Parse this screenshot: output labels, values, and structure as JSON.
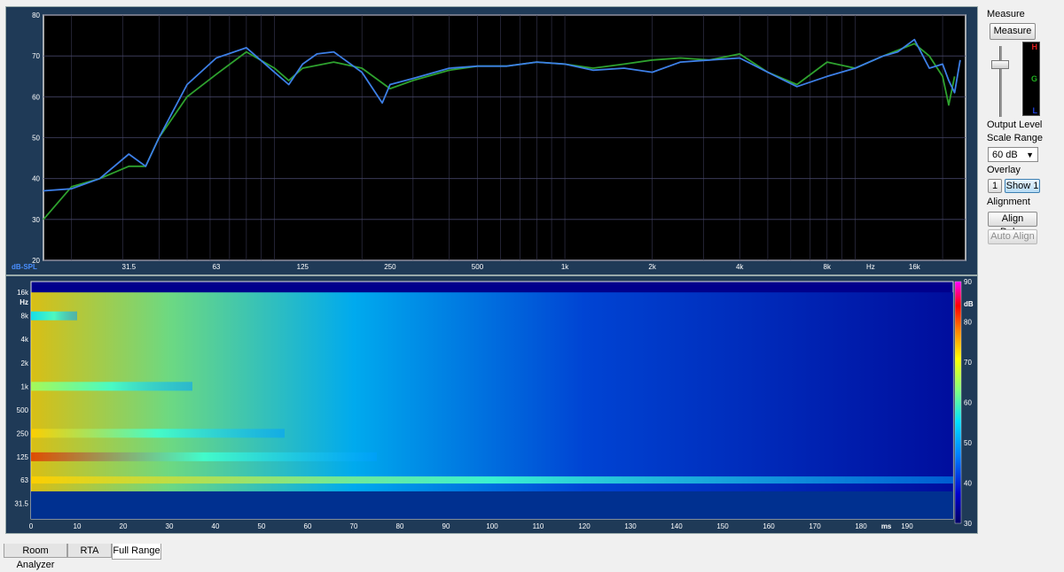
{
  "sidebar": {
    "measure_heading": "Measure",
    "measure_button": "Measure",
    "meter_labels": [
      "H",
      "G",
      "L"
    ],
    "output_level_label": "Output Level",
    "scale_range_label": "Scale Range",
    "scale_range_value": "60 dB",
    "overlay_label": "Overlay",
    "overlay_index": "1",
    "overlay_show_button": "Show 1",
    "alignment_label": "Alignment",
    "align_delay_button": "Align Delay",
    "auto_align_button": "Auto Align"
  },
  "tabs": [
    "Room Analyzer",
    "RTA",
    "Full Range"
  ],
  "selected_tab": "Full Range",
  "colors": {
    "blue_curve": "#3d7fe6",
    "green_curve": "#2ea12e",
    "plot_bg": "#000000",
    "frame_bg": "#1f3a57"
  },
  "chart_data": [
    {
      "type": "line",
      "xscale": "log",
      "ylabel": "dB-SPL",
      "x_tick_labels": [
        "31.5",
        "63",
        "125",
        "250",
        "500",
        "1k",
        "2k",
        "4k",
        "8k",
        "Hz",
        "16k"
      ],
      "y_ticks": [
        20,
        30,
        40,
        50,
        60,
        70,
        80
      ],
      "ylim": [
        20,
        80
      ],
      "xlim": [
        16,
        24000
      ],
      "grid": true,
      "series": [
        {
          "color": "blue",
          "x": [
            16,
            20,
            25,
            31.5,
            36,
            40,
            50,
            63,
            80,
            100,
            112,
            125,
            140,
            160,
            200,
            235,
            250,
            300,
            400,
            500,
            630,
            800,
            1000,
            1250,
            1600,
            2000,
            2500,
            3150,
            4000,
            5000,
            6300,
            8000,
            10000,
            12500,
            14000,
            16000,
            18000,
            20000,
            21000,
            22000,
            23000
          ],
          "y": [
            37,
            37.5,
            40,
            46,
            43,
            50,
            63,
            69.5,
            72,
            66,
            63,
            68,
            70.5,
            71,
            66,
            58.5,
            63,
            64.5,
            67,
            67.5,
            67.5,
            68.5,
            68,
            66.5,
            67,
            66,
            68.5,
            69,
            69.5,
            66,
            62.5,
            65,
            67,
            70,
            71,
            74,
            67,
            68,
            64,
            61,
            69
          ]
        },
        {
          "color": "green",
          "x": [
            16,
            20,
            25,
            31.5,
            36,
            40,
            50,
            63,
            80,
            100,
            112,
            125,
            160,
            200,
            250,
            300,
            400,
            500,
            630,
            800,
            1000,
            1250,
            1600,
            2000,
            2500,
            3150,
            4000,
            5000,
            6300,
            8000,
            10000,
            12500,
            16000,
            18000,
            20000,
            21000,
            22000
          ],
          "y": [
            30,
            38,
            40,
            43,
            43,
            50,
            60,
            65.5,
            71,
            67,
            64,
            67,
            68.5,
            67,
            62,
            64,
            66.5,
            67.5,
            67.5,
            68.5,
            68,
            67,
            68,
            69,
            69.5,
            69,
            70.5,
            66,
            63,
            68.5,
            67,
            70,
            73,
            70,
            65,
            58,
            65
          ]
        }
      ]
    },
    {
      "type": "heatmap",
      "x_tick_labels": [
        "0",
        "10",
        "20",
        "30",
        "40",
        "50",
        "60",
        "70",
        "80",
        "90",
        "100",
        "110",
        "120",
        "130",
        "140",
        "150",
        "160",
        "170",
        "180",
        "ms",
        "190"
      ],
      "xlim": [
        0,
        200
      ],
      "y_tick_labels": [
        "16k",
        "Hz",
        "8k",
        "4k",
        "2k",
        "1k",
        "500",
        "250",
        "125",
        "63",
        "31.5"
      ],
      "colorbar_ticks": [
        90,
        80,
        70,
        60,
        50,
        40,
        30
      ],
      "colorbar_unit": "dB",
      "colorbar_range": [
        30,
        90
      ],
      "bands": [
        {
          "freq": 63,
          "decay_ms": 200,
          "level": 60
        },
        {
          "freq": 125,
          "decay_ms": 75,
          "level": 65
        },
        {
          "freq": 250,
          "decay_ms": 55,
          "level": 62
        },
        {
          "freq": 1000,
          "decay_ms": 35,
          "level": 58
        },
        {
          "freq": 8000,
          "decay_ms": 10,
          "level": 52
        }
      ]
    }
  ]
}
